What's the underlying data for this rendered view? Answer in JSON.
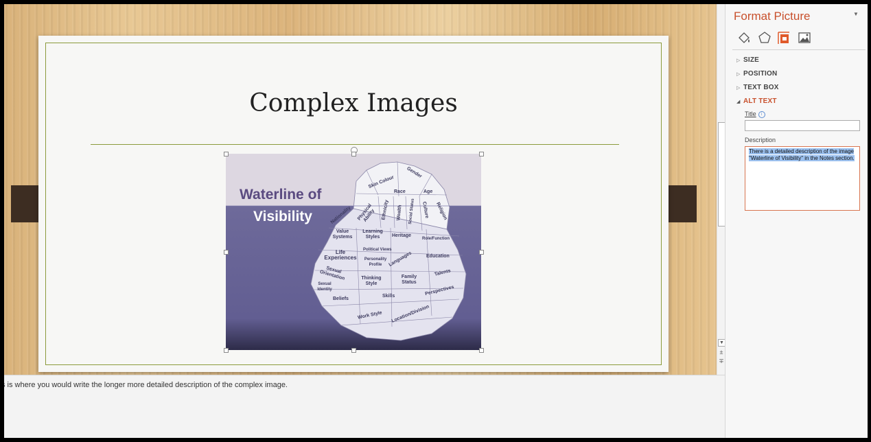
{
  "slide": {
    "title": "Complex Images",
    "picture": {
      "title_line1": "Waterline of",
      "title_line2": "Visibility",
      "labels": {
        "skin_colour": "Skin Colour",
        "gender": "Gender",
        "race": "Race",
        "age": "Age",
        "nationality": "Nationality",
        "physical_ability": "Physical Ability",
        "ethnicity": "Ethnicity",
        "wealth": "Wealth",
        "social_status": "Social Status",
        "culture": "Culture",
        "religion": "Religion",
        "value_systems": "Value Systems",
        "learning_styles": "Learning Styles",
        "heritage": "Heritage",
        "role_function": "Role/Function",
        "political_views": "Political Views",
        "life_experiences": "Life Experiences",
        "personality_profile": "Personality Profile",
        "languages": "Languages",
        "education": "Education",
        "sexual_orientation": "Sexual Orientation",
        "sexual_identity": "Sexual Identity",
        "thinking_style": "Thinking Style",
        "family_status": "Family Status",
        "talents": "Talents",
        "beliefs": "Beliefs",
        "skills": "Skills",
        "perspectives": "Perspectives",
        "work_style": "Work Style",
        "location_division": "Location/Division"
      }
    }
  },
  "notes": {
    "text": "s is where you would write the longer more detailed description of the complex image."
  },
  "format_pane": {
    "title": "Format Picture",
    "sections": {
      "size": "SIZE",
      "position": "POSITION",
      "text_box": "TEXT BOX",
      "alt_text": "ALT TEXT"
    },
    "alt_text": {
      "title_label": "Title",
      "title_value": "",
      "description_label": "Description",
      "description_value": "There is a detailed description of the image \"Waterline of Visibility\" in the Notes section."
    }
  },
  "colors": {
    "accent": "#c8502c",
    "slide_rule": "#8a9a3a",
    "selection": "#9cc1ef"
  },
  "icons": {
    "fill_line": "fill-line-icon",
    "effects": "effects-pentagon-icon",
    "size_properties": "size-properties-icon",
    "picture": "picture-icon",
    "title_info": "info-icon"
  }
}
